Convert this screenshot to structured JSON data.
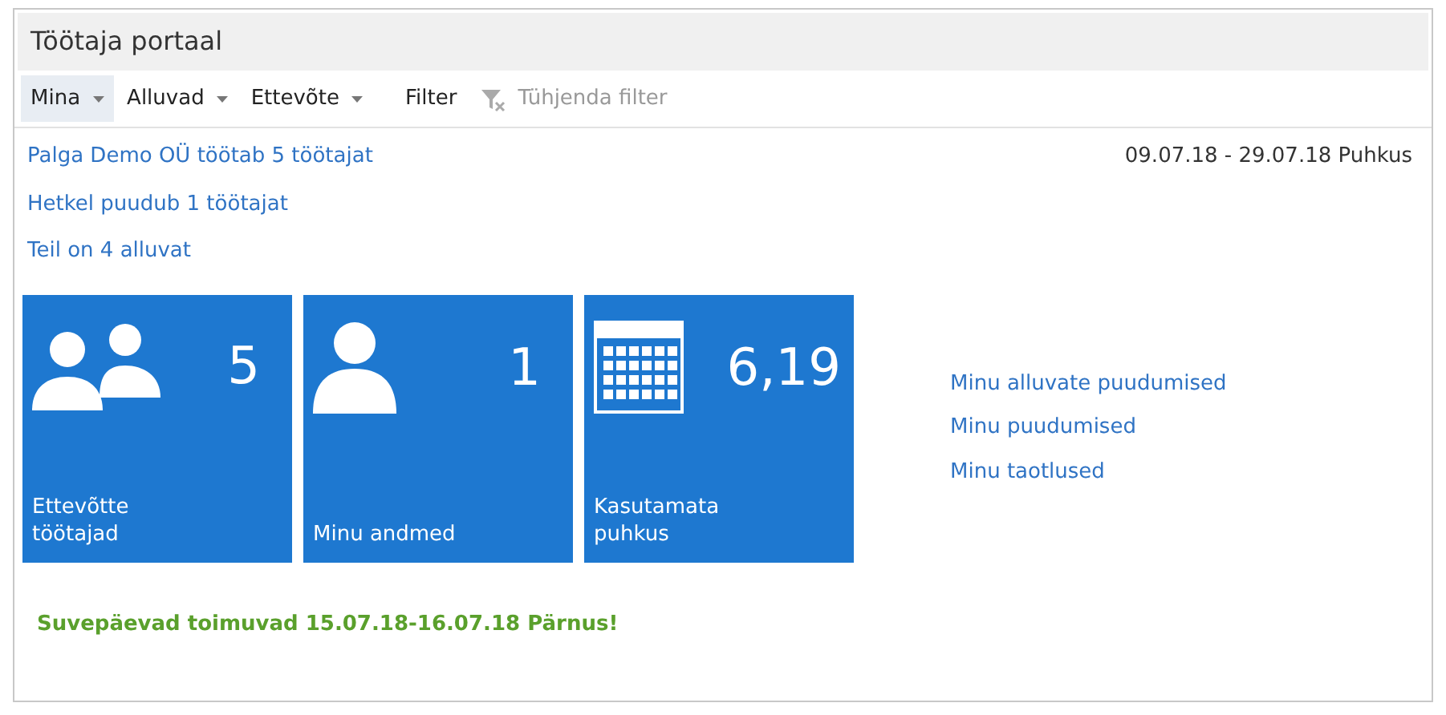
{
  "window": {
    "title": "Töötaja portaal"
  },
  "toolbar": [
    {
      "label": "Mina",
      "kind": "menu",
      "selected": true,
      "disabled": false
    },
    {
      "label": "Alluvad",
      "kind": "menu",
      "selected": false,
      "disabled": false
    },
    {
      "label": "Ettevõte",
      "kind": "menu",
      "selected": false,
      "disabled": false
    },
    {
      "label": "Filter",
      "kind": "button",
      "selected": false,
      "disabled": false
    },
    {
      "label": "Tühjenda filter",
      "kind": "clear",
      "selected": false,
      "disabled": true
    }
  ],
  "summary_links": [
    "Palga Demo OÜ töötab 5 töötajat",
    "Hetkel puudub 1 töötajat",
    "Teil on 4 alluvat"
  ],
  "absence_note": "09.07.18 - 29.07.18 Puhkus",
  "tiles": [
    {
      "kind": "people",
      "value": "5",
      "label": "Ettevõtte töötajad"
    },
    {
      "kind": "person",
      "value": "1",
      "label": "Minu andmed"
    },
    {
      "kind": "calendar",
      "value": "6,19",
      "label": "Kasutamata puhkus"
    }
  ],
  "side_links": [
    "Minu alluvate puudumised",
    "Minu puudumised",
    "Minu taotlused"
  ],
  "announcement": "Suvepäevad toimuvad 15.07.18-16.07.18 Pärnus!"
}
